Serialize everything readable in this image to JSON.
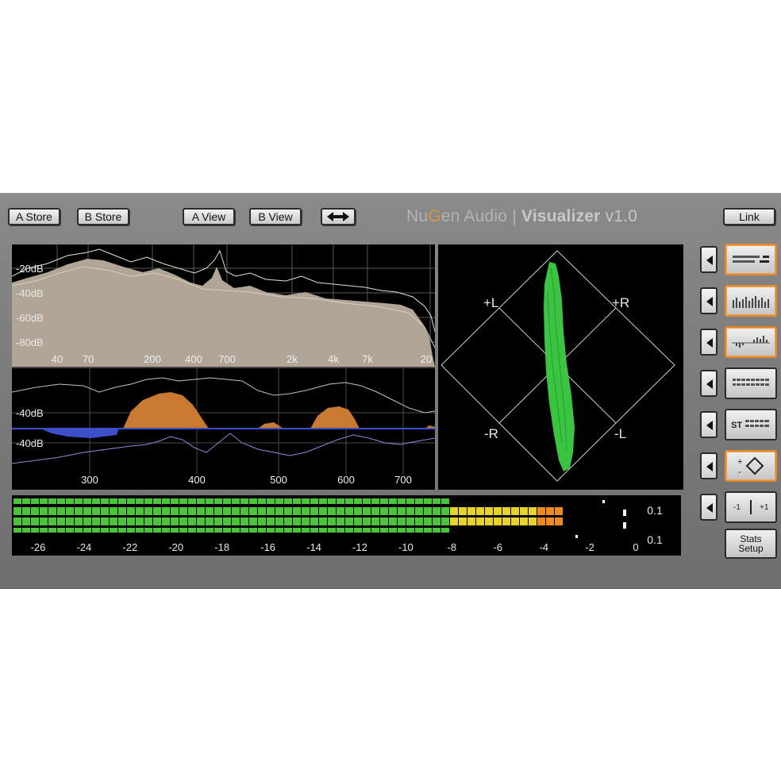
{
  "toolbar": {
    "a_store": "A Store",
    "b_store": "B Store",
    "a_view": "A View",
    "b_view": "B View",
    "swap_icon": "double-arrow-icon",
    "link": "Link"
  },
  "brand": {
    "company_nu": "Nu",
    "company_g": "G",
    "company_rest": "en Audio",
    "separator": " | ",
    "product": "Visualizer",
    "version": " v1.0"
  },
  "spectrum": {
    "y_labels": [
      "-20dB",
      "-40dB",
      "-60dB",
      "-80dB"
    ],
    "x_labels": [
      "40",
      "70",
      "200",
      "400",
      "700",
      "2k",
      "4k",
      "7k",
      "20"
    ]
  },
  "difference": {
    "y_labels": [
      "-40dB",
      "-40dB"
    ],
    "x_labels": [
      "300",
      "400",
      "500",
      "600",
      "700"
    ]
  },
  "vectorscope": {
    "labels": {
      "plus_l": "+L",
      "plus_r": "+R",
      "minus_r": "-R",
      "minus_l": "-L"
    }
  },
  "meter": {
    "scale": [
      "-26",
      "-24",
      "-22",
      "-20",
      "-18",
      "-16",
      "-14",
      "-12",
      "-10",
      "-8",
      "-6",
      "-4",
      "-2",
      "0"
    ],
    "peak_top": "0.1",
    "peak_bottom": "0.1",
    "levels_db": [
      -7.8,
      -3.0,
      -3.0,
      -7.6
    ]
  },
  "side": {
    "modes": [
      {
        "icon": "meter-bars-icon",
        "active": true
      },
      {
        "icon": "spectrum-icon",
        "active": true
      },
      {
        "icon": "difference-icon",
        "active": true
      },
      {
        "icon": "bargraph-icon",
        "active": false
      },
      {
        "icon": "stereo-bargraph-icon",
        "active": false,
        "label": "ST"
      },
      {
        "icon": "vectorscope-icon",
        "active": true,
        "label_plus": "+",
        "label_minus": "-"
      },
      {
        "icon": "correlation-icon",
        "active": false,
        "label_left": "-1",
        "label_right": "+1"
      }
    ],
    "stats_line1": "Stats",
    "stats_line2": "Setup"
  },
  "colors": {
    "spectrum_fill": "#b0a596",
    "difference_fill": "#c87a32",
    "difference_neg": "#3d4fc8",
    "scope_trace": "#3ecf46",
    "meter_green": "#4cc33a",
    "meter_yellow": "#e8d22c",
    "meter_orange": "#ec8a22",
    "meter_red": "#e0281e",
    "active_border": "#e48a2e"
  }
}
